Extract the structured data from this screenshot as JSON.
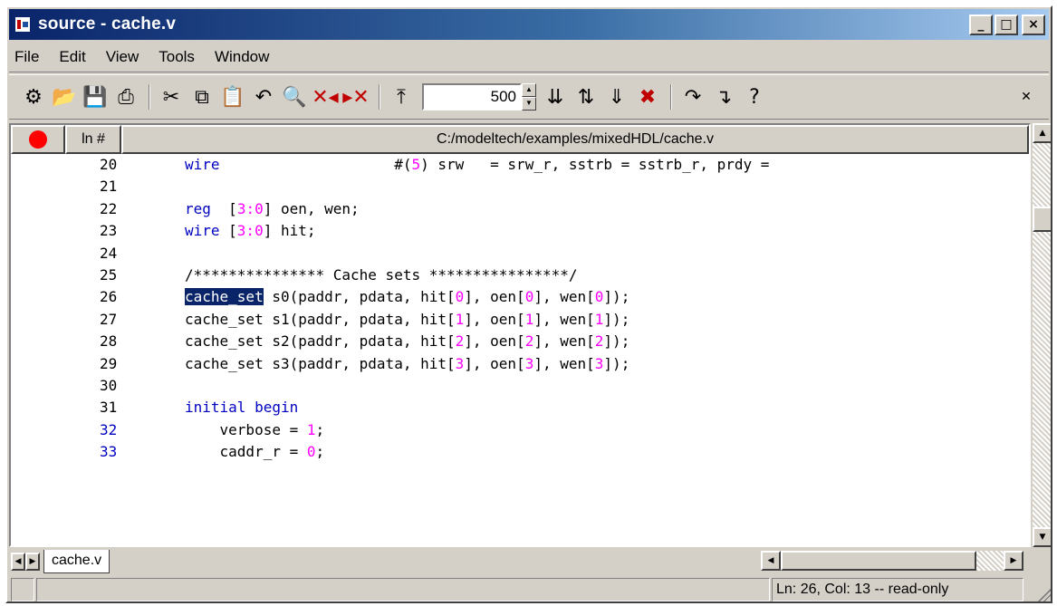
{
  "window": {
    "title": "source - cache.v"
  },
  "title_buttons": {
    "minimize": "_",
    "maximize": "□",
    "close": "×"
  },
  "menu": [
    "File",
    "Edit",
    "View",
    "Tools",
    "Window"
  ],
  "toolbar": {
    "zoom_value": "500"
  },
  "editor": {
    "file_path": "C:/modeltech/examples/mixedHDL/cache.v",
    "col_line_header": "ln #",
    "lines": [
      {
        "num": "20",
        "text": "wire                    #(5) srw   = srw_r, sstrb = sstrb_r, prdy ="
      },
      {
        "num": "21",
        "text": ""
      },
      {
        "num": "22",
        "text": "reg  [3:0] oen, wen;"
      },
      {
        "num": "23",
        "text": "wire [3:0] hit;"
      },
      {
        "num": "24",
        "text": ""
      },
      {
        "num": "25",
        "text": "/*************** Cache sets ****************/"
      },
      {
        "num": "26",
        "text": "cache_set s0(paddr, pdata, hit[0], oen[0], wen[0]);"
      },
      {
        "num": "27",
        "text": "cache_set s1(paddr, pdata, hit[1], oen[1], wen[1]);"
      },
      {
        "num": "28",
        "text": "cache_set s2(paddr, pdata, hit[2], oen[2], wen[2]);"
      },
      {
        "num": "29",
        "text": "cache_set s3(paddr, pdata, hit[3], oen[3], wen[3]);"
      },
      {
        "num": "30",
        "text": ""
      },
      {
        "num": "31",
        "text": "initial begin"
      },
      {
        "num": "32",
        "text": "    verbose = 1;"
      },
      {
        "num": "33",
        "text": "    caddr_r = 0;"
      }
    ]
  },
  "tabs": [
    "cache.v"
  ],
  "status": {
    "position": "Ln:  26, Col: 13  -- read-only"
  }
}
